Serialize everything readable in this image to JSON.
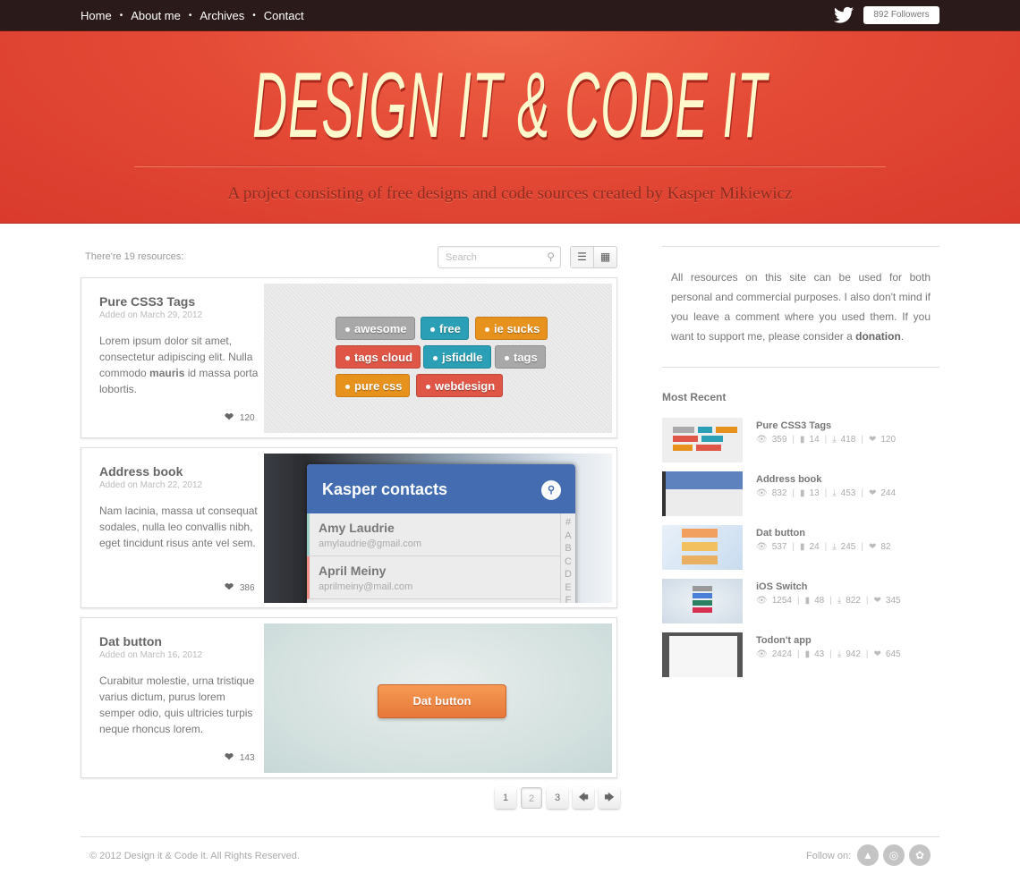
{
  "nav": {
    "items": [
      "Home",
      "About me",
      "Archives",
      "Contact"
    ],
    "separator": "•"
  },
  "twitter": {
    "icon": "twitter-bird-icon",
    "followers": "892 Followers"
  },
  "hero": {
    "title": "DESIGN IT & CODE IT",
    "subtitle": "A project consisting of free designs and code sources created by Kasper Mikiewicz"
  },
  "toolbar": {
    "count": "There're 19 resources:",
    "search_placeholder": "Search",
    "view_list": "list-view-icon",
    "view_grid": "grid-view-icon"
  },
  "cards": [
    {
      "title": "Pure CSS3 Tags",
      "date": "Added on March 29, 2012",
      "desc_before": "Lorem ipsum dolor sit amet, consectetur adipiscing elit. Nulla commodo ",
      "desc_bold": "mauris",
      "desc_after": " id massa porta lobortis.",
      "likes": "120"
    },
    {
      "title": "Address book",
      "date": "Added on March 22, 2012",
      "desc_before": "Nam lacinia, massa ut consequat sodales, nulla leo convallis nibh, eget tincidunt risus ante vel sem.",
      "desc_bold": "",
      "desc_after": "",
      "likes": "386"
    },
    {
      "title": "Dat button",
      "date": "Added on March 16, 2012",
      "desc_before": "Curabitur molestie, urna tristique varius dictum, purus lorem semper odio, quis ultricies turpis neque rhoncus lorem.",
      "desc_bold": "",
      "desc_after": "",
      "likes": "143"
    }
  ],
  "tags_preview": [
    {
      "label": "awesome",
      "color": "gray"
    },
    {
      "label": "free",
      "color": "teal"
    },
    {
      "label": "ie sucks",
      "color": "orange"
    },
    {
      "label": "tags cloud",
      "color": "red"
    },
    {
      "label": "jsfiddle",
      "color": "teal"
    },
    {
      "label": "tags",
      "color": "gray"
    },
    {
      "label": "pure css",
      "color": "orange"
    },
    {
      "label": "webdesign",
      "color": "red"
    }
  ],
  "addressbook_preview": {
    "title": "Kasper contacts",
    "contacts": [
      {
        "name": "Amy Laudrie",
        "email": "amylaudrie@gmail.com"
      },
      {
        "name": "April Meiny",
        "email": "aprilmeiny@mail.com"
      }
    ],
    "index": [
      "#",
      "A",
      "B",
      "C",
      "D",
      "E",
      "F"
    ]
  },
  "datbutton_preview": {
    "label": "Dat button"
  },
  "pagination": {
    "pages": [
      "1",
      "2",
      "3"
    ],
    "current": "2"
  },
  "sidebar": {
    "about_before": "All resources on this site can be used for both personal and commercial purposes. I also don't mind if you leave a comment where you used them. If you want to support me, please consider a ",
    "about_link": "donation",
    "about_after": ".",
    "recent_heading": "Most Recent",
    "recent": [
      {
        "title": "Pure CSS3 Tags",
        "views": "359",
        "comments": "14",
        "downloads": "418",
        "likes": "120"
      },
      {
        "title": "Address book",
        "views": "832",
        "comments": "13",
        "downloads": "453",
        "likes": "244"
      },
      {
        "title": "Dat button",
        "views": "537",
        "comments": "24",
        "downloads": "245",
        "likes": "82"
      },
      {
        "title": "iOS Switch",
        "views": "1254",
        "comments": "48",
        "downloads": "822",
        "likes": "345"
      },
      {
        "title": "Todon't app",
        "views": "2424",
        "comments": "43",
        "downloads": "942",
        "likes": "645"
      }
    ]
  },
  "footer": {
    "copyright": "© 2012 Design it & Code it. All Rights Reserved.",
    "follow_label": "Follow on:",
    "social": [
      "forrst-icon",
      "dribbble-icon",
      "twitter-icon"
    ]
  },
  "colors": {
    "topbar": "#2a1a1a",
    "hero": "#e04534",
    "title": "#fdf9cc",
    "accent_blue": "#436db0",
    "button_orange": "#f08a46"
  }
}
